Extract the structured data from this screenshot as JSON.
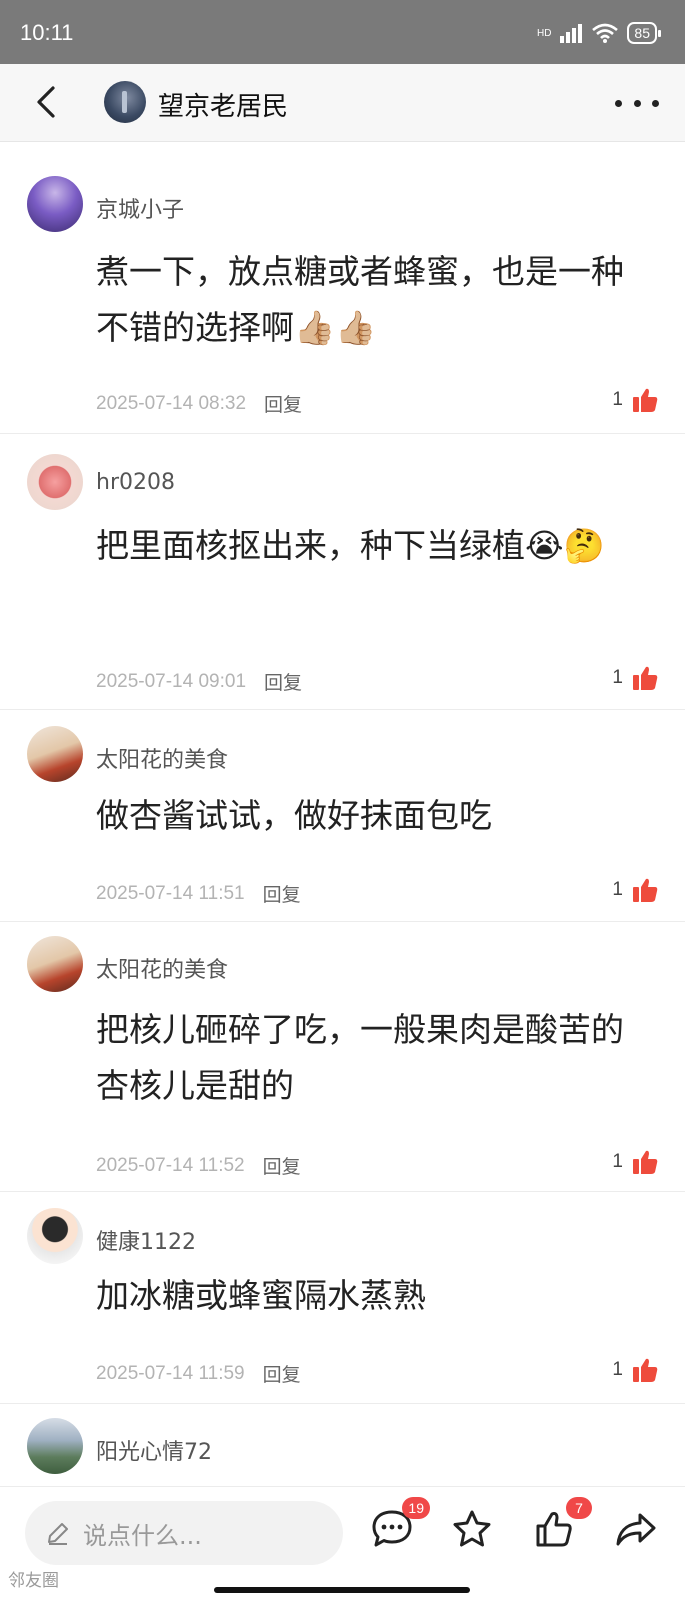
{
  "status_bar": {
    "time": "10:11",
    "network": "HD",
    "battery": "85"
  },
  "nav": {
    "title": "望京老居民"
  },
  "comments": [
    {
      "user": "京城小子",
      "text": "煮一下，放点糖或者蜂蜜，也是一种不错的选择啊👍🏼👍🏼",
      "time": "2025-07-14 08:32",
      "reply": "回复",
      "likes": "1"
    },
    {
      "user": "hr0208",
      "text": "把里面核抠出来，种下当绿植😭🤔",
      "time": "2025-07-14 09:01",
      "reply": "回复",
      "likes": "1"
    },
    {
      "user": "太阳花的美食",
      "text": "做杏酱试试，做好抹面包吃",
      "time": "2025-07-14 11:51",
      "reply": "回复",
      "likes": "1"
    },
    {
      "user": "太阳花的美食",
      "text": "把核儿砸碎了吃，一般果肉是酸苦的杏核儿是甜的",
      "time": "2025-07-14 11:52",
      "reply": "回复",
      "likes": "1"
    },
    {
      "user": "健康1122",
      "text": "加冰糖或蜂蜜隔水蒸熟",
      "time": "2025-07-14 11:59",
      "reply": "回复",
      "likes": "1"
    },
    {
      "user": "阳光心情72"
    }
  ],
  "bottom_bar": {
    "input_placeholder": "说点什么...",
    "comment_count": "19",
    "like_count": "7"
  },
  "watermark": "邻友圈",
  "colors": {
    "accent": "#f04848",
    "like": "#ee4b3c",
    "status_bar": "#7a7a7a"
  },
  "icons": [
    "back-arrow-icon",
    "more-icon",
    "thumbs-up-icon",
    "pencil-icon",
    "comment-bubble-icon",
    "star-icon",
    "like-outline-icon",
    "share-icon"
  ]
}
